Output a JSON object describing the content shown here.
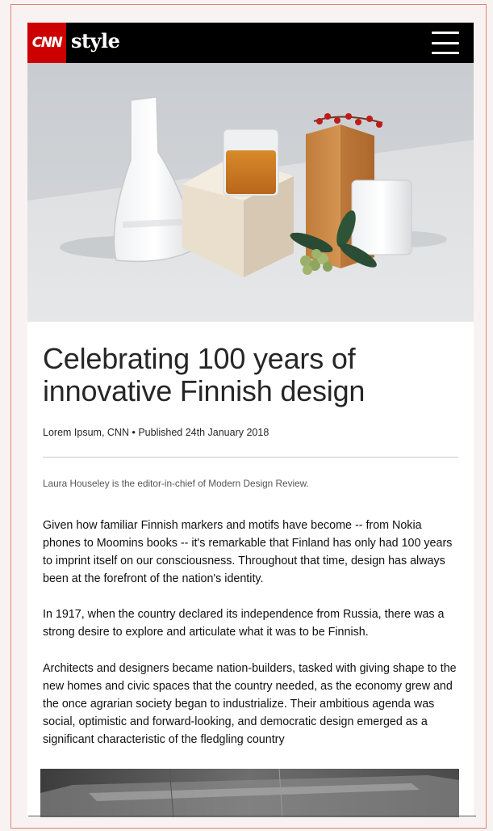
{
  "header": {
    "brand": "CNN",
    "section": "style",
    "menu_icon": "hamburger-menu-icon"
  },
  "article": {
    "headline": "Celebrating 100 years of innovative Finnish design",
    "byline": {
      "author": "Lorem Ipsum, CNN",
      "separator": "•",
      "published": "Published 24th January 2018"
    },
    "editor_note": "Laura Houseley is the editor-in-chief of Modern Design Review.",
    "paragraphs": [
      "Given how familiar Finnish markers and motifs have become -- from Nokia phones to Moomins books -- it's remarkable that Finland has only had 100 years to imprint itself on our consciousness. Throughout that time, design has always been at the forefront of the nation's identity.",
      "In 1917, when the country declared its independence from Russia, there was a strong desire to explore and articulate what it was to be Finnish.",
      "Architects and designers became nation-builders, tasked with giving shape to the new homes and civic spaces that the country needed, as the economy grew and the once agrarian society began to industrialize. Their ambitious agenda was social, optimistic and forward-looking, and democratic design emerged as a significant characteristic of the fledgling country"
    ]
  },
  "colors": {
    "brand_red": "#cc0000",
    "header_bg": "#000000",
    "frame_border": "#e2826f"
  }
}
